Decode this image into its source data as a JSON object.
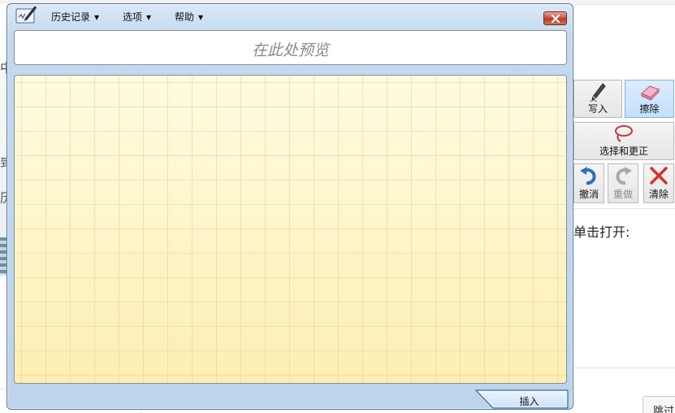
{
  "window": {
    "menu": {
      "history": "历史记录",
      "options": "选项",
      "help": "帮助"
    },
    "preview_placeholder": "在此处预览",
    "insert_label": "插入"
  },
  "tools": {
    "write": "写入",
    "erase": "擦除",
    "select_correct": "选择和更正",
    "undo": "撤消",
    "redo": "重做",
    "clear": "清除"
  },
  "background": {
    "text_click_open": "单击打开:",
    "skip_button": "跳过",
    "left_glyph_1": "中",
    "left_glyph_2": "到",
    "left_glyph_3": "历"
  },
  "colors": {
    "pad_yellow": "#fdf6c9",
    "window_frame": "#c3d9ef",
    "close_red": "#c8503a",
    "active_tool": "#c4e0fb"
  }
}
